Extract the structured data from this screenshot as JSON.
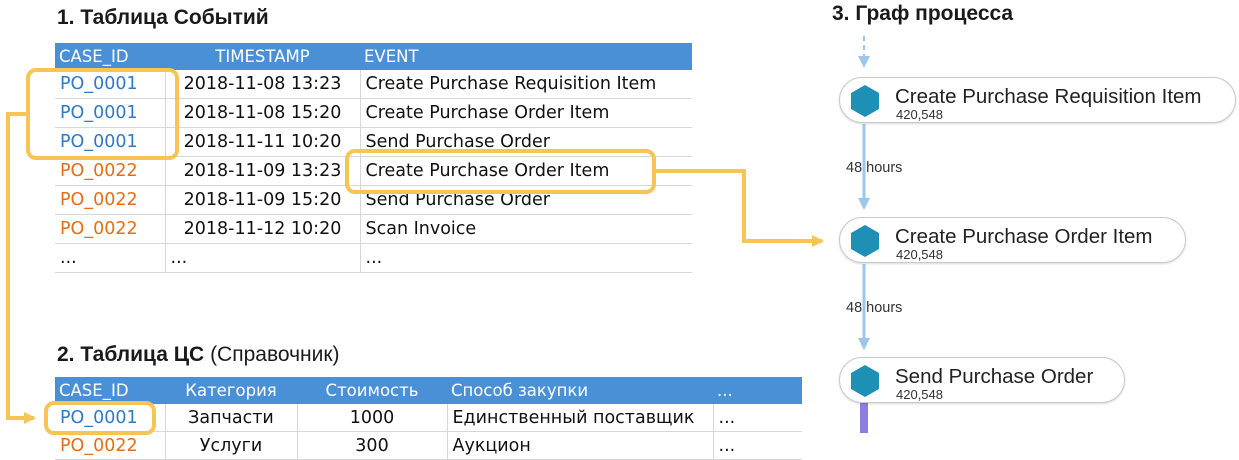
{
  "headings": {
    "event_table": "1. Таблица Событий",
    "ref_table_bold": "2. Таблица ЦС",
    "ref_table_normal": "(Справочник)",
    "process_graph": "3. Граф процесса"
  },
  "event_table": {
    "columns": [
      "CASE_ID",
      "TIMESTAMP",
      "EVENT"
    ],
    "rows": [
      {
        "case_id": "PO_0001",
        "timestamp": "2018-11-08 13:23",
        "event": "Create Purchase Requisition Item"
      },
      {
        "case_id": "PO_0001",
        "timestamp": "2018-11-08 15:20",
        "event": "Create Purchase Order Item"
      },
      {
        "case_id": "PO_0001",
        "timestamp": "2018-11-11 10:20",
        "event": "Send Purchase Order"
      },
      {
        "case_id": "PO_0022",
        "timestamp": "2018-11-09 13:23",
        "event": "Create Purchase Order Item"
      },
      {
        "case_id": "PO_0022",
        "timestamp": "2018-11-09 15:20",
        "event": "Send Purchase Order"
      },
      {
        "case_id": "PO_0022",
        "timestamp": "2018-11-12 10:20",
        "event": "Scan Invoice"
      },
      {
        "case_id": "...",
        "timestamp": "...",
        "event": "..."
      }
    ]
  },
  "ref_table": {
    "columns": [
      "CASE_ID",
      "Категория",
      "Стоимость",
      "Способ закупки",
      "..."
    ],
    "rows": [
      {
        "case_id": "PO_0001",
        "category": "Запчасти",
        "cost": "1000",
        "method": "Единственный поставщик",
        "more": "..."
      },
      {
        "case_id": "PO_0022",
        "category": "Услуги",
        "cost": "300",
        "method": "Аукцион",
        "more": "..."
      }
    ]
  },
  "process_graph": {
    "nodes": [
      {
        "label": "Create Purchase Requisition Item",
        "count": "420,548"
      },
      {
        "label": "Create Purchase Order Item",
        "count": "420,548"
      },
      {
        "label": "Send Purchase Order",
        "count": "420,548"
      }
    ],
    "edges": [
      {
        "label": "48 hours"
      },
      {
        "label": "48 hours"
      }
    ]
  },
  "colors": {
    "header_blue": "#4a90d6",
    "case_blue": "#2e7bc4",
    "case_orange": "#e46e18",
    "highlight_yellow": "#f6c553",
    "node_teal": "#1e8fb5",
    "edge_blue": "#9cc6ec",
    "edge_purple": "#8a7fe0"
  }
}
